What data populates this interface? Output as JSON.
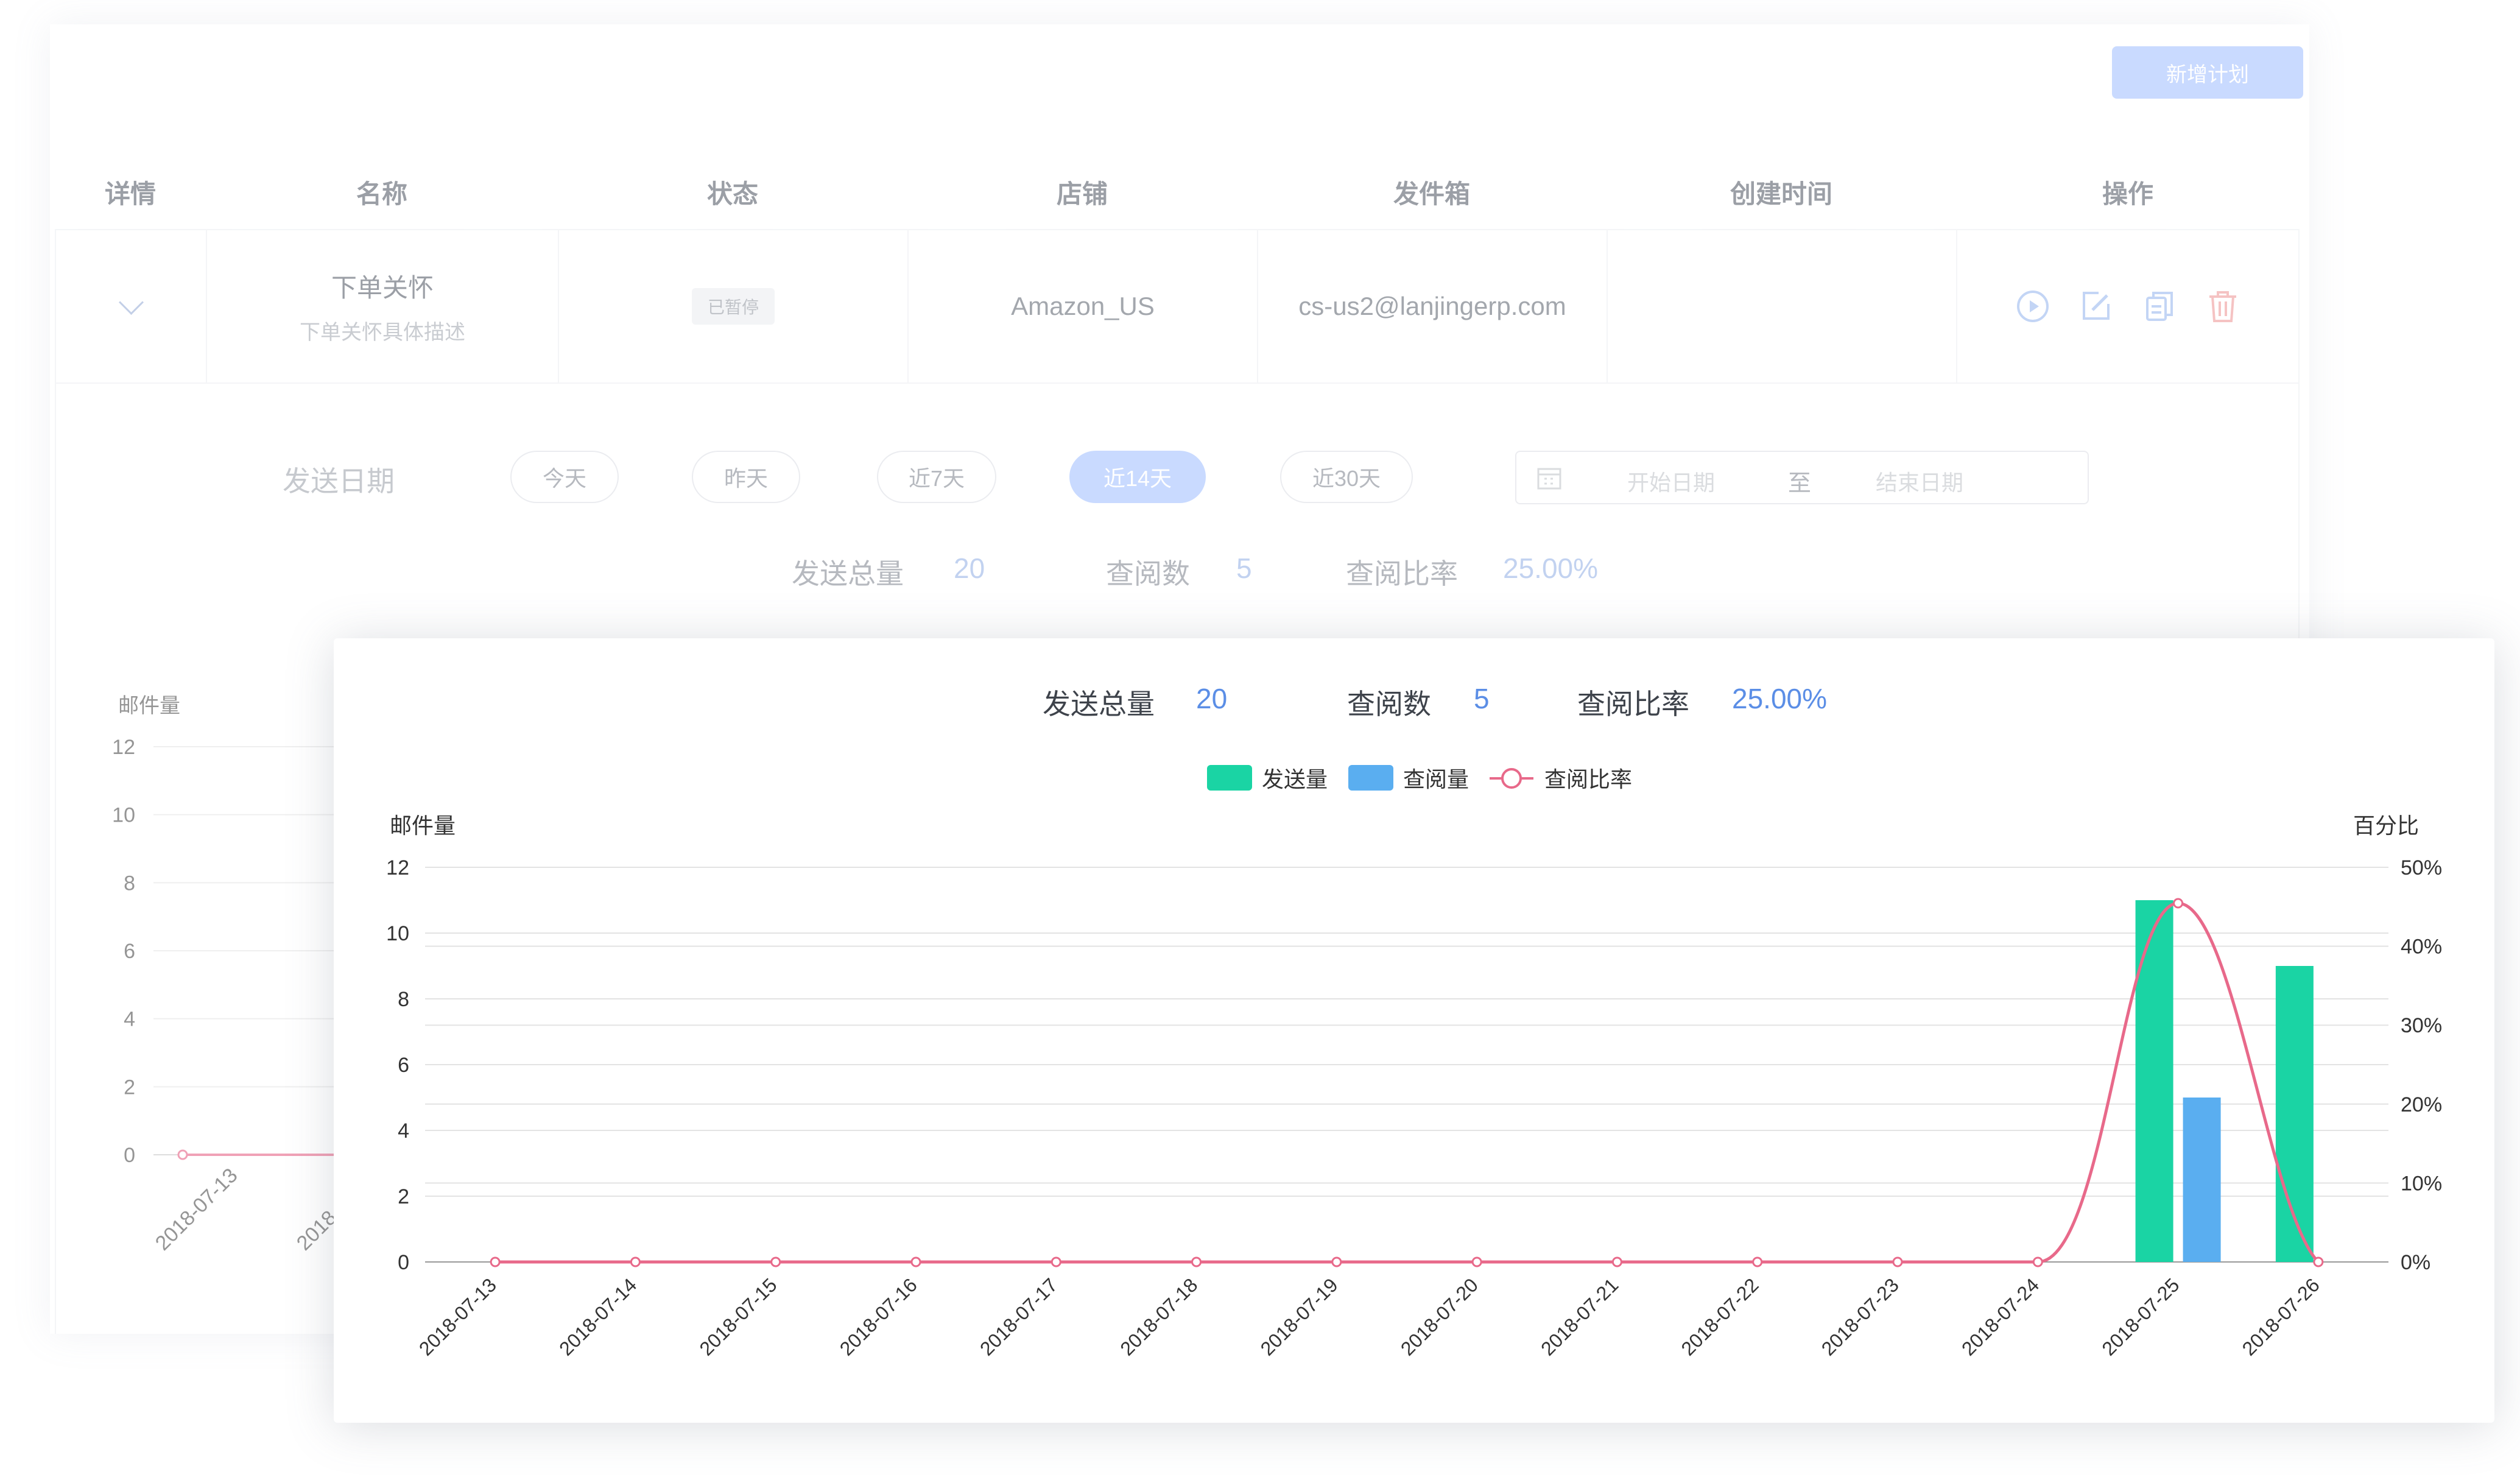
{
  "toolbar": {
    "add_plan_label": "新增计划"
  },
  "table": {
    "headers": [
      "详情",
      "名称",
      "状态",
      "店铺",
      "发件箱",
      "创建时间",
      "操作"
    ],
    "row": {
      "name": "下单关怀",
      "description": "下单关怀具体描述",
      "status": "已暂停",
      "shop": "Amazon_US",
      "mailbox": "cs-us2@lanjingerp.com",
      "created": ""
    }
  },
  "filters": {
    "date_label": "发送日期",
    "ranges": [
      "今天",
      "昨天",
      "近7天",
      "近14天",
      "近30天"
    ],
    "active_range": "近14天",
    "start_placeholder": "开始日期",
    "to_label": "至",
    "end_placeholder": "结束日期"
  },
  "summary": {
    "total_sent_label": "发送总量",
    "total_sent": "20",
    "reads_label": "查阅数",
    "reads": "5",
    "rate_label": "查阅比率",
    "rate": "25.00%"
  },
  "colors": {
    "sent": "#1ad4a4",
    "read": "#5aaef0",
    "rate": "#e8698a",
    "accent": "#a9c5ff"
  },
  "chart_data": {
    "type": "bar",
    "categories": [
      "2018-07-13",
      "2018-07-14",
      "2018-07-15",
      "2018-07-16",
      "2018-07-17",
      "2018-07-18",
      "2018-07-19",
      "2018-07-20",
      "2018-07-21",
      "2018-07-22",
      "2018-07-23",
      "2018-07-24",
      "2018-07-25",
      "2018-07-26"
    ],
    "series": [
      {
        "name": "发送量",
        "kind": "bar",
        "axis": "left",
        "values": [
          0,
          0,
          0,
          0,
          0,
          0,
          0,
          0,
          0,
          0,
          0,
          0,
          11,
          9
        ]
      },
      {
        "name": "查阅量",
        "kind": "bar",
        "axis": "left",
        "values": [
          0,
          0,
          0,
          0,
          0,
          0,
          0,
          0,
          0,
          0,
          0,
          0,
          5,
          0
        ]
      },
      {
        "name": "查阅比率",
        "kind": "line",
        "axis": "right",
        "values": [
          0,
          0,
          0,
          0,
          0,
          0,
          0,
          0,
          0,
          0,
          0,
          0,
          45.45,
          0
        ]
      }
    ],
    "ylabel": "邮件量",
    "y2label": "百分比",
    "ylim": [
      0,
      12
    ],
    "yticks": [
      0,
      2,
      4,
      6,
      8,
      10,
      12
    ],
    "y2lim": [
      0,
      50
    ],
    "y2ticks": [
      "0%",
      "10%",
      "20%",
      "30%",
      "40%",
      "50%"
    ],
    "legend": "top-center",
    "grid": true
  }
}
